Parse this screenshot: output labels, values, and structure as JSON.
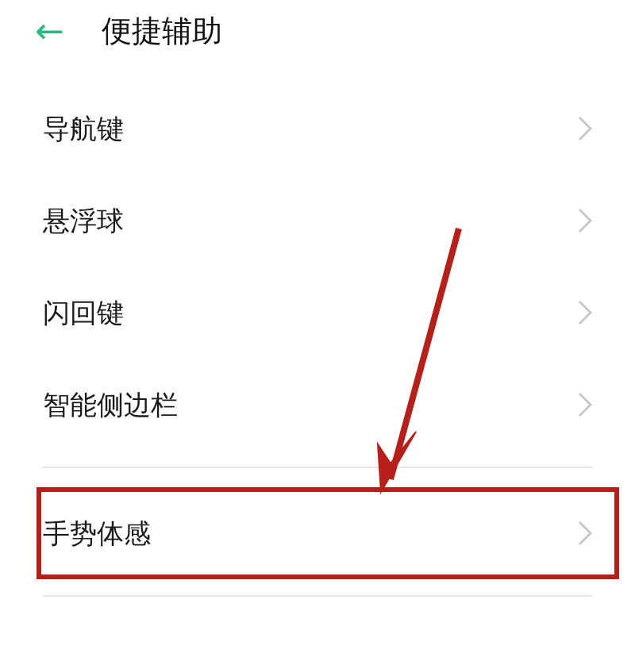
{
  "header": {
    "back_icon": "←",
    "title": "便捷辅助"
  },
  "sections": [
    {
      "items": [
        {
          "label": "导航键",
          "highlighted": false
        },
        {
          "label": "悬浮球",
          "highlighted": false
        },
        {
          "label": "闪回键",
          "highlighted": false
        },
        {
          "label": "智能侧边栏",
          "highlighted": false
        }
      ]
    },
    {
      "items": [
        {
          "label": "手势体感",
          "highlighted": true
        }
      ]
    }
  ],
  "annotation": {
    "kind": "arrow"
  }
}
